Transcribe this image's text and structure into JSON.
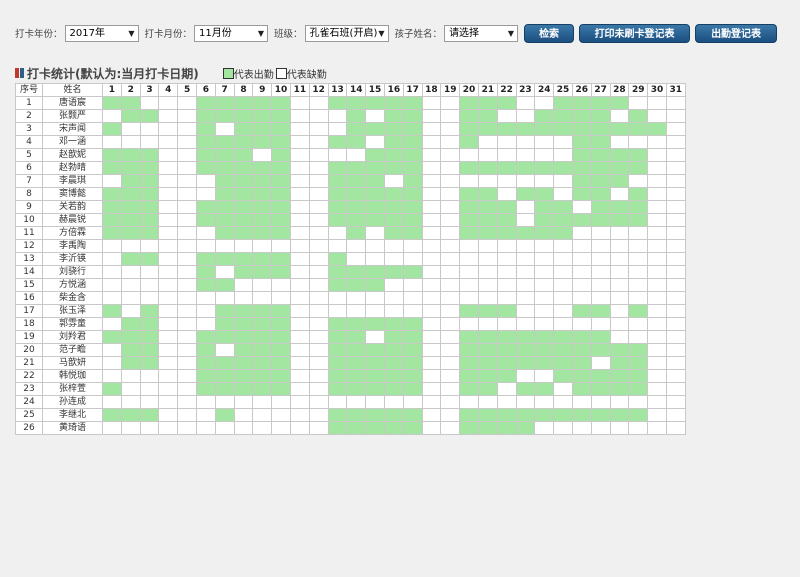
{
  "filters": {
    "year_label": "打卡年份：",
    "year_value": "2017年",
    "month_label": "打卡月份：",
    "month_value": "11月份",
    "class_label": "班级：",
    "class_value": "孔雀石班(开启)",
    "child_label": "孩子姓名：",
    "child_value": "请选择"
  },
  "buttons": {
    "search": "检索",
    "print_unpunched": "打印未刷卡登记表",
    "attendance_register": "出勤登记表"
  },
  "section": {
    "title": "打卡统计(默认为:当月打卡日期)",
    "legend_present": "代表出勤",
    "legend_absent": "代表缺勤",
    "present_color": "#a2e6a2",
    "absent_color": "#ffffff"
  },
  "table": {
    "header_index": "序号",
    "header_name": "姓名",
    "days": [
      "1",
      "2",
      "3",
      "4",
      "5",
      "6",
      "7",
      "8",
      "9",
      "10",
      "11",
      "12",
      "13",
      "14",
      "15",
      "16",
      "17",
      "18",
      "19",
      "20",
      "21",
      "22",
      "23",
      "24",
      "25",
      "26",
      "27",
      "28",
      "29",
      "30",
      "31"
    ],
    "rows": [
      {
        "index": "1",
        "name": "唐语宸",
        "att": "1100011111001111100111001111000"
      },
      {
        "index": "2",
        "name": "张颢严",
        "att": "0110011111000101100110011110100"
      },
      {
        "index": "3",
        "name": "宋声闻",
        "att": "1000010111000111100111111111110"
      },
      {
        "index": "4",
        "name": "邓一涵",
        "att": "0000011111001101100100000110000"
      },
      {
        "index": "5",
        "name": "赵歆妮",
        "att": "1110011101000011100000000111100"
      },
      {
        "index": "6",
        "name": "赵勃晴",
        "att": "1110011111001111100111111111100"
      },
      {
        "index": "7",
        "name": "李晨琪",
        "att": "0110001111001110100000000111000"
      },
      {
        "index": "8",
        "name": "窦博懿",
        "att": "1110001111001111100110110110100"
      },
      {
        "index": "9",
        "name": "关若韵",
        "att": "1110011111001111100111011011100"
      },
      {
        "index": "10",
        "name": "赫晨锐",
        "att": "1110011111001111100111011111100"
      },
      {
        "index": "11",
        "name": "方倍霖",
        "att": "1110001111000101100111111000000"
      },
      {
        "index": "12",
        "name": "李禹陶",
        "att": "0000000000000000000000000000000"
      },
      {
        "index": "13",
        "name": "李沂锳",
        "att": "0110011111001000000000000000000"
      },
      {
        "index": "14",
        "name": "刘骁行",
        "att": "0000010111001111100000000000000"
      },
      {
        "index": "15",
        "name": "方悦涵",
        "att": "0000011000001110000000000000000"
      },
      {
        "index": "16",
        "name": "柴金含",
        "att": "0000000000000000000000000000000"
      },
      {
        "index": "17",
        "name": "张玉泽",
        "att": "1010001111000000000111000110100"
      },
      {
        "index": "18",
        "name": "郭雰童",
        "att": "0110001111001111100000000000000"
      },
      {
        "index": "19",
        "name": "刘羚君",
        "att": "1110011111001101100111111110000"
      },
      {
        "index": "20",
        "name": "范子瞻",
        "att": "0110010111001111100111111111100"
      },
      {
        "index": "21",
        "name": "马歆妍",
        "att": "0110011111001111100111111101100"
      },
      {
        "index": "22",
        "name": "韩悦珈",
        "att": "0000011111001111100111001111100"
      },
      {
        "index": "23",
        "name": "张梓萱",
        "att": "1000011111001111100110110111100"
      },
      {
        "index": "24",
        "name": "孙连成",
        "att": "0000000000000000000000000000000"
      },
      {
        "index": "25",
        "name": "李继北",
        "att": "1110001000001111100111111111100"
      },
      {
        "index": "26",
        "name": "黄琦语",
        "att": "0000000000001111100111100000000"
      }
    ]
  }
}
